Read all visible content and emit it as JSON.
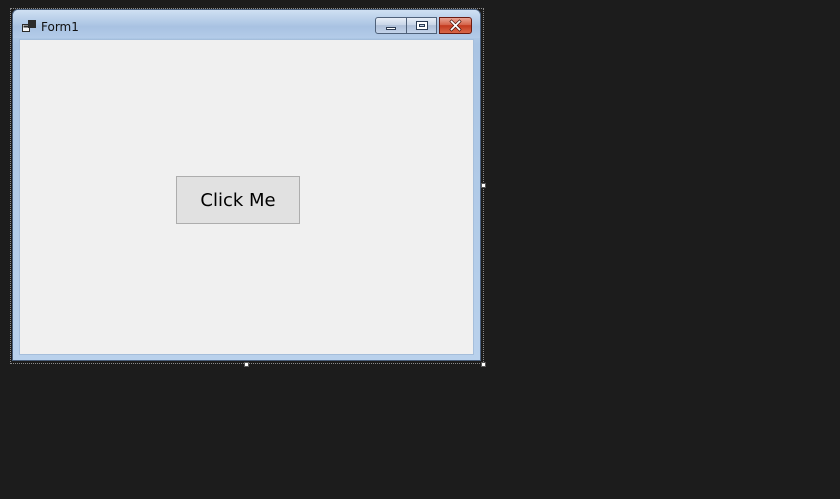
{
  "form": {
    "title": "Form1",
    "icon": "form-app-icon"
  },
  "caption_buttons": {
    "minimize_icon": "minimize-icon",
    "maximize_icon": "maximize-icon",
    "close_icon": "close-icon"
  },
  "content": {
    "button_label": "Click Me"
  },
  "colors": {
    "designer_background": "#1c1c1c",
    "client_area": "#f0f0f0",
    "button_face": "#e1e1e1",
    "close_button": "#c2391d"
  }
}
